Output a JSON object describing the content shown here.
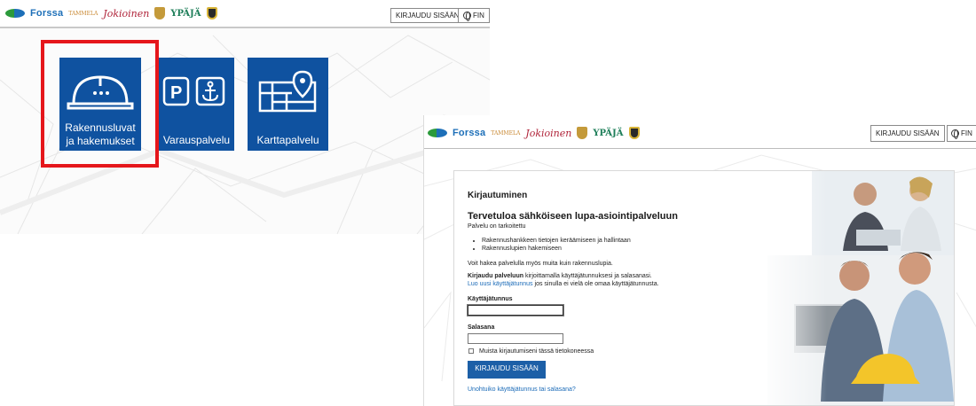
{
  "left": {
    "header": {
      "logos": {
        "forssa": "Forssa",
        "tammela": "TAMMELA",
        "jokioinen": "Jokioinen",
        "ypaja": "YPÄJÄ",
        "icons": [
          "forssa-logo-icon",
          "jokioinen-crest-icon",
          "tammela-crest-icon"
        ]
      },
      "login_label": "KIRJAUDU SISÄÄN",
      "lang_label": "FIN"
    },
    "tiles": [
      {
        "label_line1": "Rakennusluvat",
        "label_line2": "ja hakemukset",
        "icon": "hard-hat-icon"
      },
      {
        "label": "Varauspalvelu",
        "icon": "parking-anchor-icon"
      },
      {
        "label": "Karttapalvelu",
        "icon": "map-pin-icon"
      }
    ],
    "colors": {
      "tile": "#0f52a0",
      "highlight": "#e5161b"
    }
  },
  "right": {
    "header": {
      "logos": {
        "forssa": "Forssa",
        "tammela": "TAMMELA",
        "jokioinen": "Jokioinen",
        "ypaja": "YPÄJÄ"
      },
      "login_label": "KIRJAUDU SISÄÄN",
      "lang_label": "FIN"
    },
    "login": {
      "title": "Kirjautuminen",
      "welcome": "Tervetuloa sähköiseen lupa-asiointipalveluun",
      "intro": "Palvelu on tarkoitettu",
      "bullets": [
        "Rakennushankkeen tietojen keräämiseen ja hallintaan",
        "Rakennuslupien hakemiseen"
      ],
      "other_use": "Voit hakea palvelulla myös muita kuin rakennuslupia.",
      "instruction_bold": "Kirjaudu palveluun",
      "instruction_rest": " kirjoittamalla käyttäjätunnuksesi ja salasanasi.",
      "create_link": "Luo uusi käyttäjätunnus",
      "create_rest": " jos sinulla ei vielä ole omaa käyttäjätunnusta.",
      "username_label": "Käyttäjätunnus",
      "username_value": "",
      "password_label": "Salasana",
      "password_value": "",
      "remember_label": "Muista kirjautumiseni tässä tietokoneessa",
      "remember_checked": false,
      "submit_label": "KIRJAUDU SISÄÄN",
      "forgot_link": "Unohtuiko käyttäjätunnus tai salasana?"
    },
    "colors": {
      "button": "#1c5fa7",
      "link": "#1b6bb8"
    }
  }
}
